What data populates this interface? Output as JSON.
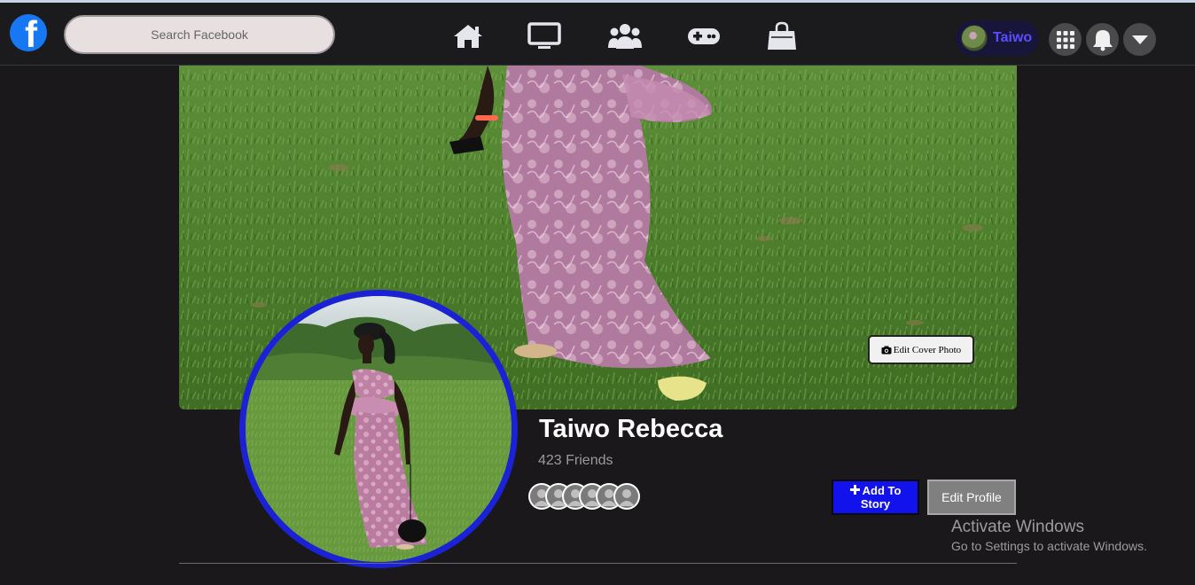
{
  "app": {
    "logo_letter": "f",
    "logo_color": "#1877f2"
  },
  "search": {
    "placeholder": "Search Facebook"
  },
  "nav": {
    "icons": [
      "home-icon",
      "tv-icon",
      "groups-icon",
      "gaming-icon",
      "marketplace-icon"
    ]
  },
  "account": {
    "name": "Taiwo",
    "name_color": "#5a4cff"
  },
  "header_actions": [
    "menu-grid-icon",
    "notifications-bell-icon",
    "account-dropdown-icon"
  ],
  "cover": {
    "edit_label": "Edit Cover Photo"
  },
  "profile": {
    "name": "Taiwo Rebecca",
    "friends": "423 Friends",
    "avatar_ring_color": "#1b22d6"
  },
  "actions": {
    "add_story_label": "Add To Story",
    "edit_profile_label": "Edit Profile",
    "add_story_color": "#1212ec"
  },
  "watermark": {
    "title": "Activate Windows",
    "subtitle": "Go to Settings to activate Windows."
  }
}
